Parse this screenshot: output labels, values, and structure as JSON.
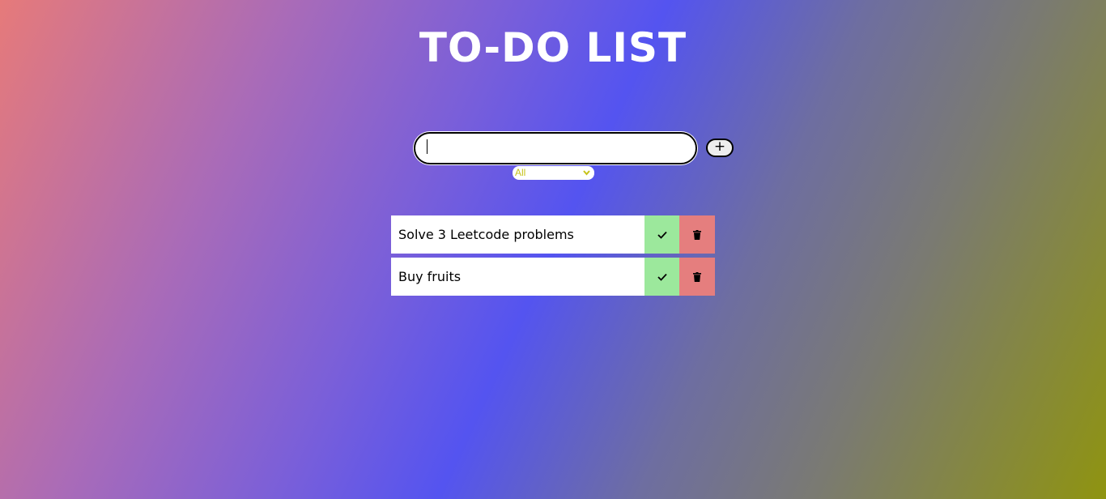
{
  "page": {
    "title": "TO-DO LIST"
  },
  "form": {
    "input_value": "",
    "input_placeholder": "",
    "add_icon": "plus-icon",
    "add_label": "+"
  },
  "filter": {
    "selected": "All",
    "options": [
      "All"
    ]
  },
  "todos": [
    {
      "text": "Solve 3 Leetcode problems",
      "complete_icon": "check-icon",
      "delete_icon": "trash-icon"
    },
    {
      "text": "Buy fruits",
      "complete_icon": "check-icon",
      "delete_icon": "trash-icon"
    }
  ],
  "colors": {
    "complete": "#9ce89c",
    "delete": "#e57e7e",
    "filter_text": "#c6c21a"
  }
}
